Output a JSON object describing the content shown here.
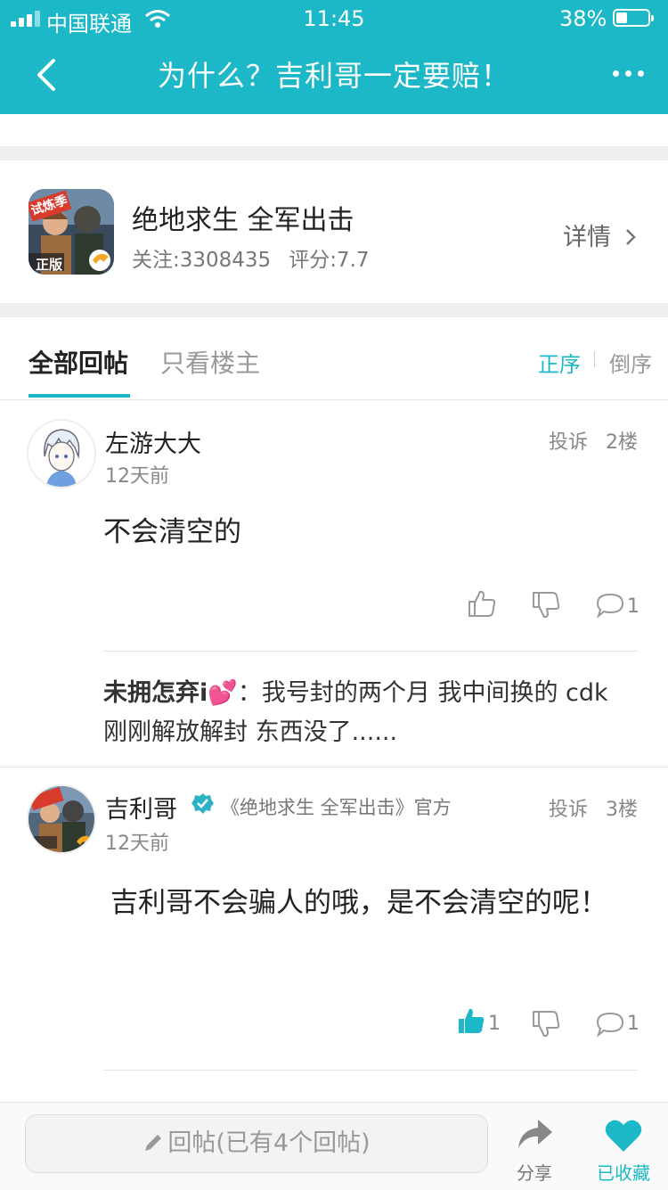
{
  "status_bar": {
    "carrier": "中国联通",
    "time": "11:45",
    "battery": "38%",
    "battery_level": 0.38
  },
  "nav": {
    "title": "为什么？吉利哥一定要赔！"
  },
  "game": {
    "name": "绝地求生 全军出击",
    "follow": "关注:3308435",
    "rating": "评分:7.7",
    "detail": "详情",
    "icon_badge": "正版",
    "icon_banner": "试炼季"
  },
  "tabs": {
    "all": "全部回帖",
    "owner_only": "只看楼主",
    "asc": "正序",
    "desc": "倒序"
  },
  "posts": [
    {
      "user": "左游大大",
      "time": "12天前",
      "report": "投诉",
      "floor": "2楼",
      "content": "不会清空的",
      "likes": "",
      "comments": "1",
      "reply_user": "未拥怎弃i💕",
      "reply_text": "：我号封的两个月 我中间换的 cdk 刚刚解放解封 东西没了......"
    },
    {
      "user": "吉利哥",
      "official": "《绝地求生 全军出击》官方",
      "time": "12天前",
      "report": "投诉",
      "floor": "3楼",
      "content": "吉利哥不会骗人的哦，是不会清空的呢！",
      "likes": "1",
      "comments": "1"
    }
  ],
  "bottom": {
    "reply_placeholder": "回帖(已有4个回帖)",
    "share": "分享",
    "favorited": "已收藏"
  },
  "colors": {
    "accent": "#1cb8c8"
  }
}
